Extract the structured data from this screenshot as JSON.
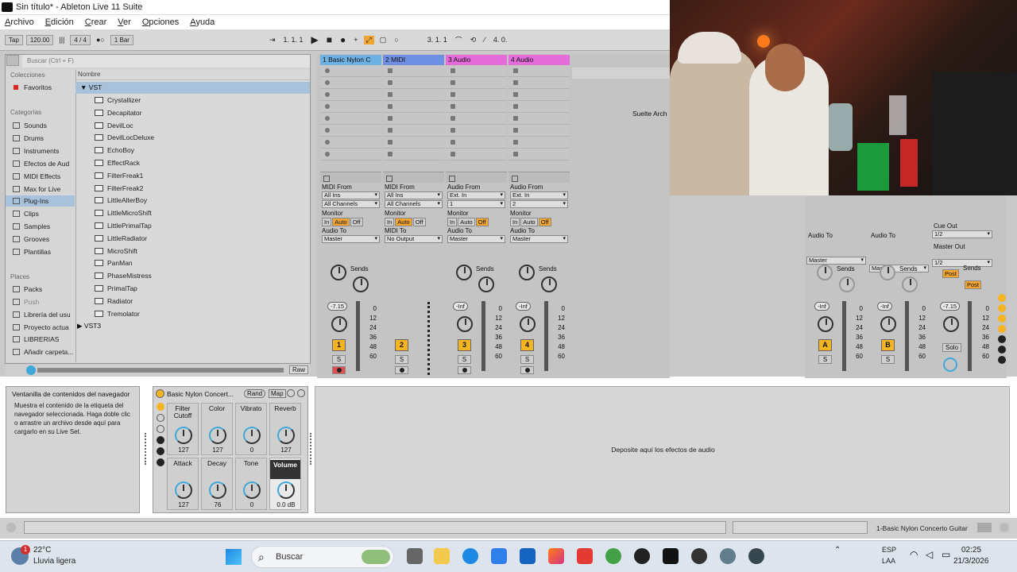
{
  "window": {
    "title": "Sin título* - Ableton Live 11 Suite"
  },
  "menu": [
    "Archivo",
    "Edición",
    "Crear",
    "Ver",
    "Opciones",
    "Ayuda"
  ],
  "control_bar": {
    "tap": "Tap",
    "tempo": "120.00",
    "signature": "4 / 4",
    "quantize": "1 Bar",
    "position": "1.   1.   1",
    "loop_start": "3.   1.   1",
    "loop_length": "4.   0."
  },
  "browser": {
    "search_placeholder": "Buscar (Ctrl + F)",
    "collections_header": "Colecciones",
    "favorites": "Favoritos",
    "categories_header": "Categorías",
    "categories": [
      "Sounds",
      "Drums",
      "Instruments",
      "Efectos de Aud",
      "MIDI Effects",
      "Max for Live",
      "Plug-Ins",
      "Clips",
      "Samples",
      "Grooves",
      "Plantillas"
    ],
    "places_header": "Places",
    "places": [
      "Packs",
      "Push",
      "Librería del usu",
      "Proyecto actua",
      "LIBRERIAS",
      "Añadir carpeta..."
    ],
    "name_header": "Nombre",
    "folder": "VST",
    "items": [
      "Crystallizer",
      "Decapitator",
      "DevilLoc",
      "DevilLocDeluxe",
      "EchoBoy",
      "EffectRack",
      "FilterFreak1",
      "FilterFreak2",
      "LittleAlterBoy",
      "LittleMicroShift",
      "LittlePrimalTap",
      "LittleRadiator",
      "MicroShift",
      "PanMan",
      "PhaseMistress",
      "PrimalTap",
      "Radiator",
      "Tremolator"
    ],
    "folder2": "VST3",
    "raw": "Raw"
  },
  "tracks": [
    {
      "name": "1 Basic Nylon C",
      "color": "#6fb0e2",
      "input_label": "MIDI From",
      "input": "All Ins",
      "channel": "All Channels",
      "volume": "-7.15",
      "number": "1"
    },
    {
      "name": "2 MIDI",
      "color": "#6f8fe2",
      "input_label": "MIDI From",
      "input": "All Ins",
      "channel": "All Channels",
      "volume": "",
      "number": "2",
      "output": "No Output"
    },
    {
      "name": "3 Audio",
      "color": "#e36cd9",
      "input_label": "Audio From",
      "input": "Ext. In",
      "channel": "1",
      "volume": "-Inf",
      "number": "3"
    },
    {
      "name": "4 Audio",
      "color": "#e36cd9",
      "input_label": "Audio From",
      "input": "Ext. In",
      "channel": "2",
      "volume": "-Inf",
      "number": "4"
    }
  ],
  "mixer_labels": {
    "monitor": "Monitor",
    "in": "In",
    "auto": "Auto",
    "off": "Off",
    "audio_to": "Audio To",
    "midi_to": "MIDI To",
    "master": "Master",
    "sends": "Sends",
    "s": "S",
    "scale": [
      "0",
      "12",
      "24",
      "36",
      "48",
      "60"
    ]
  },
  "returns": [
    {
      "letter": "A",
      "volume": "-Inf"
    },
    {
      "letter": "B",
      "volume": "-Inf"
    }
  ],
  "master": {
    "cue_out": "Cue Out",
    "cue_value": "1/2",
    "master_out": "Master Out",
    "master_value": "1/2",
    "volume": "-7.15",
    "solo": "Solo",
    "post": "Post"
  },
  "drop_hint": "Suelte Arch",
  "info": {
    "title": "Ventanilla de contenidos del navegador",
    "body": "Muestra el contenido de la etiqueta del navegador seleccionada. Haga doble clic o arrastre un archivo desde aquí para cargarlo en su Live Set."
  },
  "device": {
    "name": "Basic Nylon Concert...",
    "rand": "Rand",
    "map": "Map",
    "macros": [
      {
        "label": "Filter Cutoff",
        "value": "127"
      },
      {
        "label": "Color",
        "value": "127"
      },
      {
        "label": "Vibrato",
        "value": "0"
      },
      {
        "label": "Reverb",
        "value": "127"
      },
      {
        "label": "Attack",
        "value": "127"
      },
      {
        "label": "Decay",
        "value": "76"
      },
      {
        "label": "Tone",
        "value": "0"
      },
      {
        "label": "Volume",
        "value": "0.0 dB"
      }
    ]
  },
  "fx_drop": "Deposite aquí los efectos de audio",
  "status_track": "1-Basic Nylon Concerto Guitar",
  "taskbar": {
    "weather_temp": "22°C",
    "weather_desc": "Lluvia ligera",
    "search": "Buscar",
    "lang1": "ESP",
    "lang2": "LAA",
    "time": "02:25",
    "date": "21/3/2026",
    "badge": "1"
  }
}
